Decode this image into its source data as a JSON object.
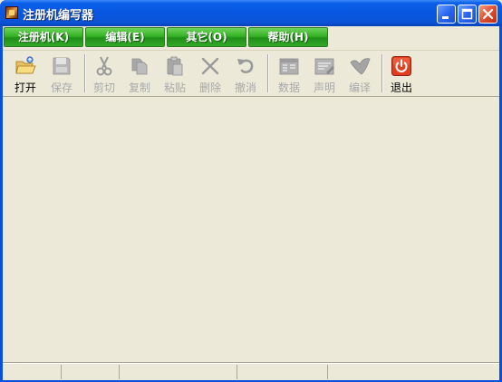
{
  "window": {
    "title": "注册机编写器",
    "app_icon": "app-icon",
    "title_buttons": [
      "minimize-icon",
      "maximize-icon",
      "close-icon"
    ]
  },
  "menu": {
    "items": [
      {
        "label": "注册机(K)"
      },
      {
        "label": "编辑(E)"
      },
      {
        "label": "其它(O)"
      },
      {
        "label": "帮助(H)"
      }
    ],
    "accent_color": "#34b224"
  },
  "toolbar": {
    "items": [
      {
        "label": "打开",
        "icon": "open-folder-icon",
        "enabled": true
      },
      {
        "label": "保存",
        "icon": "save-icon",
        "enabled": false
      },
      {
        "label": "剪切",
        "icon": "cut-icon",
        "enabled": false
      },
      {
        "label": "复制",
        "icon": "copy-icon",
        "enabled": false
      },
      {
        "label": "粘贴",
        "icon": "paste-icon",
        "enabled": false
      },
      {
        "label": "删除",
        "icon": "delete-icon",
        "enabled": false
      },
      {
        "label": "撤消",
        "icon": "undo-icon",
        "enabled": false
      },
      {
        "label": "数据",
        "icon": "data-icon",
        "enabled": false
      },
      {
        "label": "声明",
        "icon": "statement-icon",
        "enabled": false
      },
      {
        "label": "编译",
        "icon": "compile-icon",
        "enabled": false
      },
      {
        "label": "退出",
        "icon": "exit-power-icon",
        "enabled": true
      }
    ],
    "disabled_color": "#a9a9a9",
    "exit_color": "#e04020"
  },
  "statusbar": {
    "panels": [
      "",
      "",
      "",
      "",
      ""
    ]
  }
}
